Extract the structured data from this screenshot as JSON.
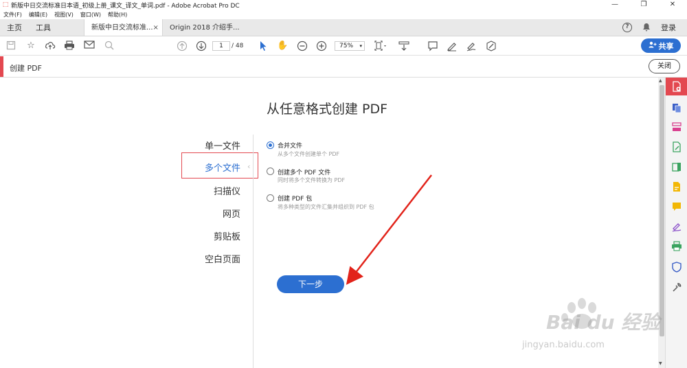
{
  "window": {
    "title": "新版中日交流标准日本语_初级上册_课文_译文_单词.pdf - Adobe Acrobat Pro DC",
    "controls": [
      "—",
      "❐",
      "✕"
    ]
  },
  "menu": [
    "文件(F)",
    "编辑(E)",
    "视图(V)",
    "窗口(W)",
    "帮助(H)"
  ],
  "tabs": {
    "home": "主页",
    "tools": "工具",
    "doc_active": "新版中日交流标准...",
    "doc_active_close": "×",
    "doc_other": "Origin 2018 介绍手...",
    "login": "登录"
  },
  "toolbar": {
    "page_current": "1",
    "page_total": "/ 48",
    "zoom": "75%",
    "share_label": "共享"
  },
  "create_bar": {
    "title": "创建 PDF",
    "close_label": "关闭"
  },
  "main": {
    "heading": "从任意格式创建 PDF",
    "sources": [
      {
        "label": "单一文件"
      },
      {
        "label": "多个文件"
      },
      {
        "label": "扫描仪"
      },
      {
        "label": "网页"
      },
      {
        "label": "剪贴板"
      },
      {
        "label": "空白页面"
      }
    ],
    "selected_source": "多个文件",
    "options": [
      {
        "label": "合并文件",
        "desc": "从多个文件创建单个 PDF",
        "selected": true
      },
      {
        "label": "创建多个 PDF 文件",
        "desc": "同时将多个文件转换为 PDF",
        "selected": false
      },
      {
        "label": "创建 PDF 包",
        "desc": "将多种类型的文件汇集并组织到 PDF 包",
        "selected": false
      }
    ],
    "next_label": "下一步"
  },
  "watermark": {
    "brand": "Bai du 经验",
    "url": "jingyan.baidu.com"
  },
  "colors": {
    "accent": "#2c6fd1",
    "red": "#e34850"
  }
}
